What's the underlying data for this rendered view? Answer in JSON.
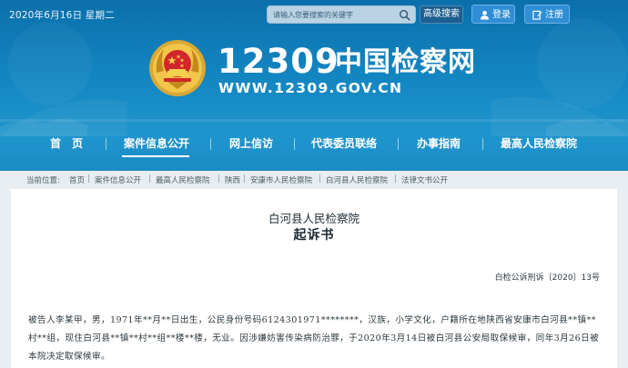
{
  "topbar": {
    "date": "2020年6月16日 星期二",
    "search_placeholder": "请输入您要搜索的关键字",
    "advanced_search": "高级搜索",
    "login": "登录",
    "register": "注册"
  },
  "logo": {
    "number": "12309",
    "name": "中国检察网",
    "url": "WWW.12309.GOV.CN"
  },
  "nav": {
    "items": [
      {
        "label": "首　页"
      },
      {
        "label": "案件信息公开"
      },
      {
        "label": "网上信访"
      },
      {
        "label": "代表委员联络"
      },
      {
        "label": "办事指南"
      },
      {
        "label": "最高人民检察院"
      }
    ],
    "active_index": 1
  },
  "breadcrumb": {
    "prefix": "当前位置:",
    "items": [
      "首页",
      "案件信息公开",
      "最高人民检察院",
      "陕西",
      "安康市人民检察院",
      "白河县人民检察院",
      "法律文书公开"
    ]
  },
  "document": {
    "organization": "白河县人民检察院",
    "title": "起诉书",
    "number": "白检公诉刑诉〔2020〕13号",
    "paragraph": "被告人李某甲，男，1971年**月**日出生，公民身份号码6124301971********，汉族，小学文化，户籍所在地陕西省安康市白河县**镇**村**组，现住白河县**镇**村**组**楼**楼，无业。因涉嫌妨害传染病防治罪，于2020年3月14日被白河县公安局取保候审，同年3月26日被本院决定取保候审。"
  },
  "colors": {
    "header_blue": "#1386c1",
    "button_blue": "#2f8ed6",
    "page_bg": "#e9eef2"
  }
}
